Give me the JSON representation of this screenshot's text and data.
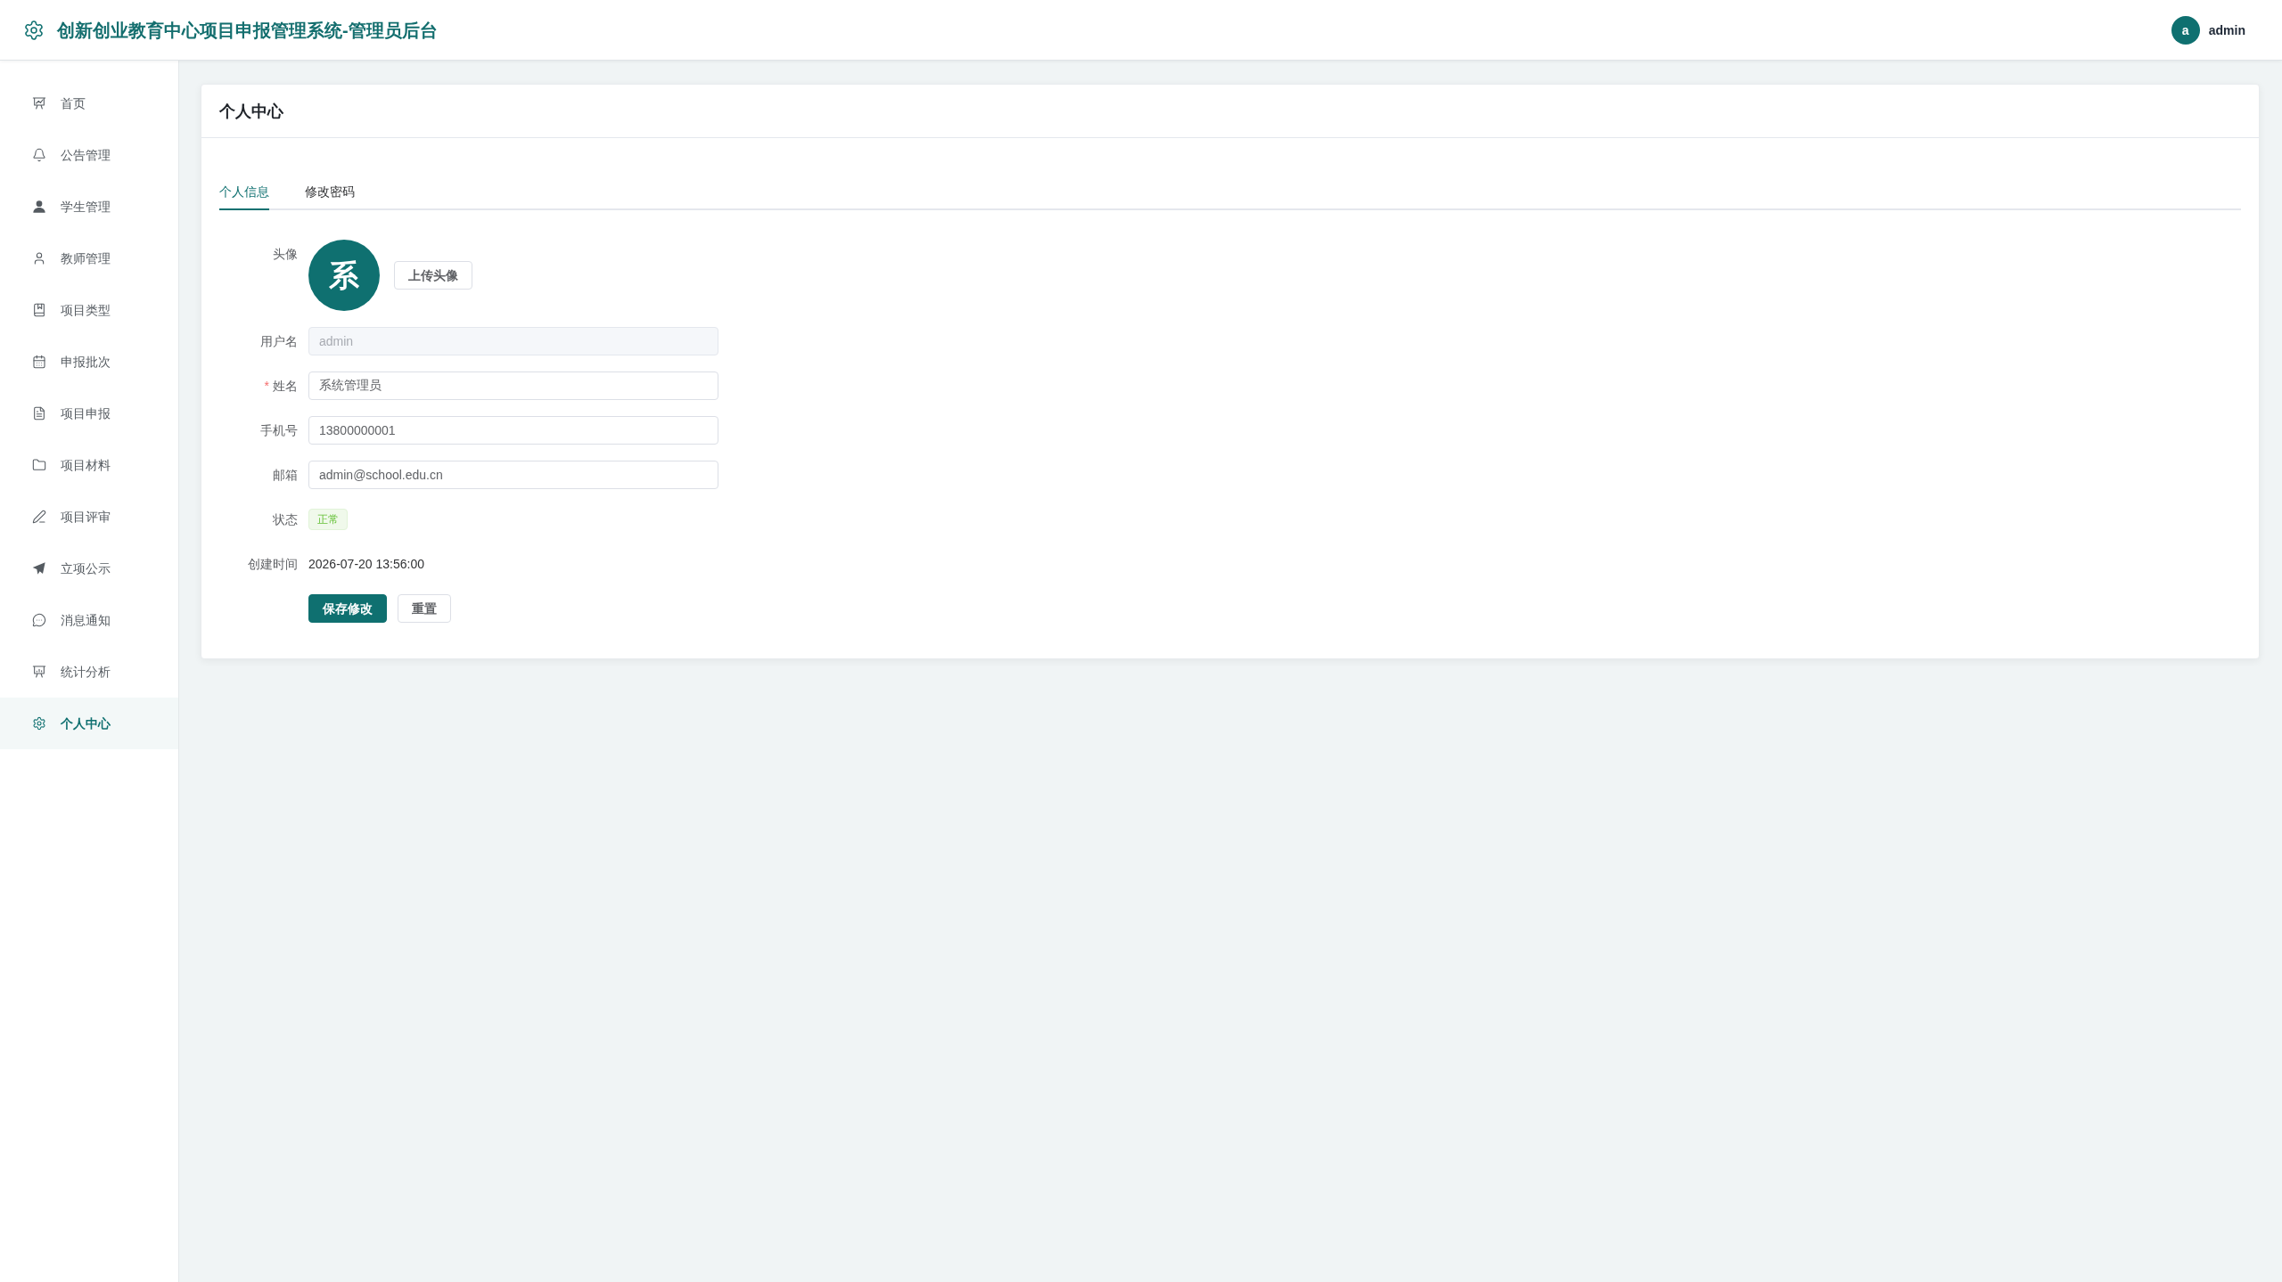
{
  "header": {
    "title": "创新创业教育中心项目申报管理系统-管理员后台",
    "user": {
      "avatar_text": "a",
      "name": "admin"
    }
  },
  "sidebar": {
    "items": [
      {
        "label": "首页",
        "selected": false
      },
      {
        "label": "公告管理",
        "selected": false
      },
      {
        "label": "学生管理",
        "selected": false
      },
      {
        "label": "教师管理",
        "selected": false
      },
      {
        "label": "项目类型",
        "selected": false
      },
      {
        "label": "申报批次",
        "selected": false
      },
      {
        "label": "项目申报",
        "selected": false
      },
      {
        "label": "项目材料",
        "selected": false
      },
      {
        "label": "项目评审",
        "selected": false
      },
      {
        "label": "立项公示",
        "selected": false
      },
      {
        "label": "消息通知",
        "selected": false
      },
      {
        "label": "统计分析",
        "selected": false
      },
      {
        "label": "个人中心",
        "selected": true
      }
    ]
  },
  "card": {
    "title": "个人中心",
    "tabs": [
      {
        "label": "个人信息",
        "selected": true
      },
      {
        "label": "修改密码",
        "selected": false
      }
    ],
    "form": {
      "fields": [
        {
          "kind": "avatar",
          "label": "头像",
          "avatar_text": "系",
          "button": "上传头像"
        },
        {
          "kind": "input",
          "label": "用户名",
          "value": "admin",
          "disabled": true
        },
        {
          "kind": "input",
          "label": "姓名",
          "required_mark": "*",
          "value": "系统管理员",
          "disabled": false
        },
        {
          "kind": "input",
          "label": "手机号",
          "value": "13800000001",
          "disabled": false
        },
        {
          "kind": "input",
          "label": "邮箱",
          "value": "admin@school.edu.cn",
          "disabled": false
        },
        {
          "kind": "tag",
          "label": "状态",
          "value": "正常"
        },
        {
          "kind": "text",
          "label": "创建时间",
          "value": "2026-07-20 13:56:00"
        }
      ],
      "buttons": [
        {
          "kind": "primary",
          "label": "保存修改"
        },
        {
          "kind": "default",
          "label": "重置"
        }
      ]
    }
  }
}
